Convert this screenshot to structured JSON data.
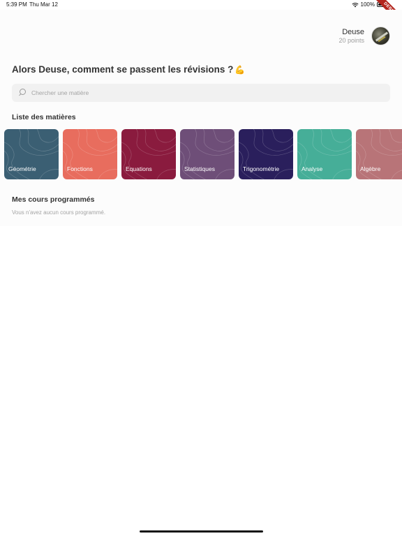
{
  "status_bar": {
    "time": "5:39 PM",
    "date": "Thu Mar 12",
    "battery": "100%"
  },
  "debug_banner": "DEBUG",
  "profile": {
    "name": "Deuse",
    "points": "20 points",
    "avatar_icon": "avatar-photo"
  },
  "greeting": {
    "text": "Alors Deuse, comment se passent les révisions ?",
    "emoji": "💪"
  },
  "search": {
    "placeholder": "Chercher une matière",
    "value": ""
  },
  "subjects_section": {
    "title": "Liste des matières",
    "items": [
      {
        "label": "Géométrie",
        "color": "#3b5f73"
      },
      {
        "label": "Fonctions",
        "color": "#e86d5e"
      },
      {
        "label": "Equations",
        "color": "#8a1b3e"
      },
      {
        "label": "Statistiques",
        "color": "#6e4e78"
      },
      {
        "label": "Trigonométrie",
        "color": "#2a1f5c"
      },
      {
        "label": "Analyse",
        "color": "#46ae98"
      },
      {
        "label": "Algèbre",
        "color": "#b87478"
      }
    ]
  },
  "courses_section": {
    "title": "Mes cours programmés",
    "empty_text": "Vous n'avez aucun cours programmé."
  }
}
